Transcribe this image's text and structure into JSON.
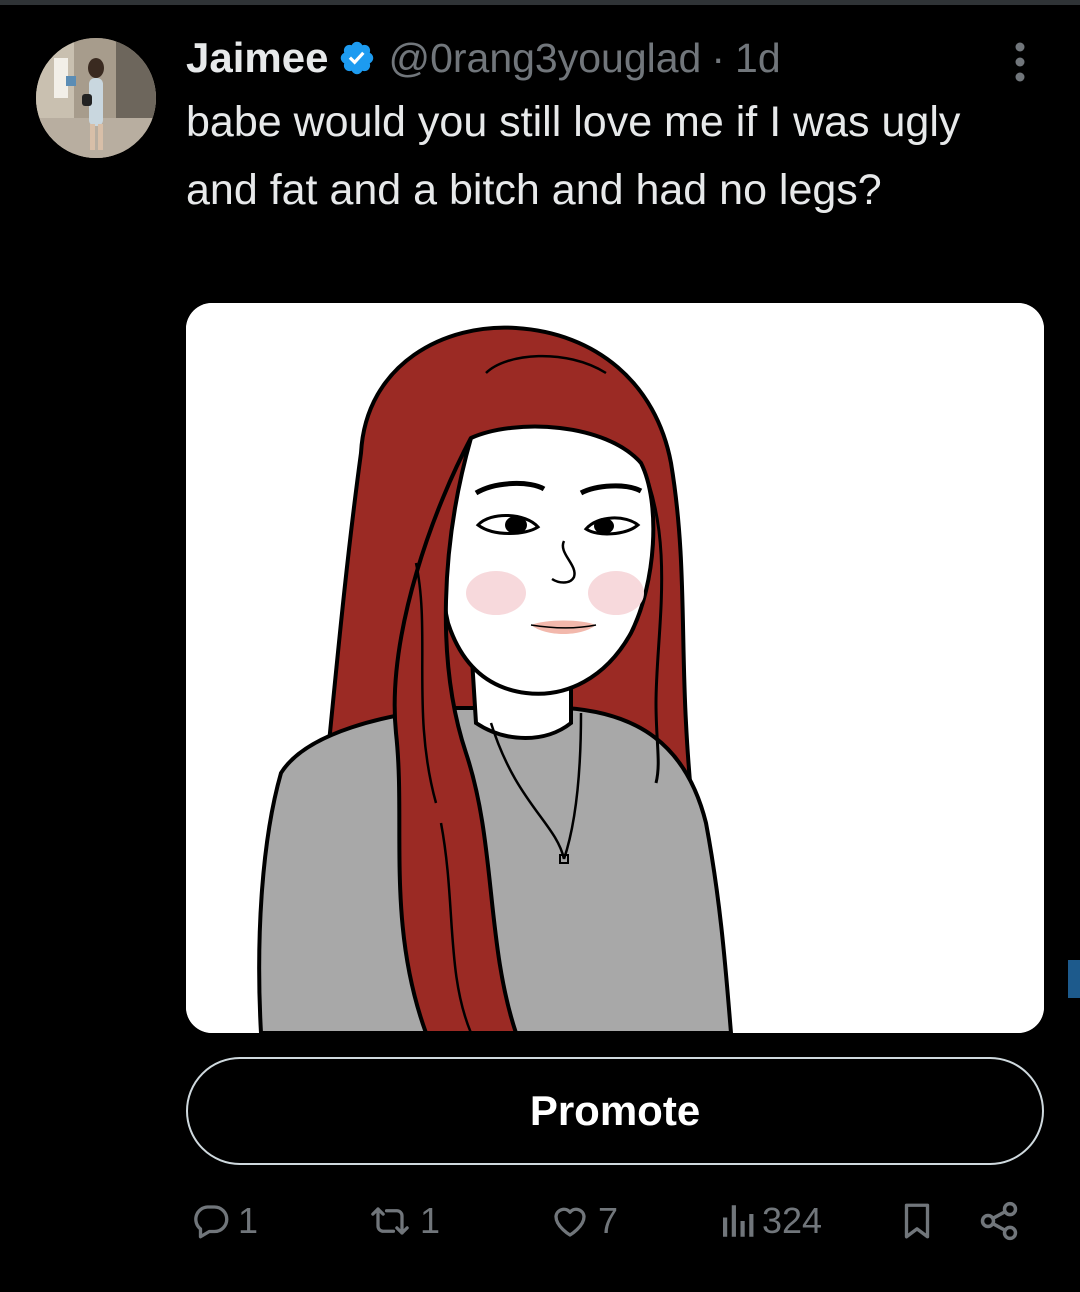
{
  "tweet": {
    "author": {
      "name": "Jaimee",
      "handle": "@0rang3youglad",
      "verified": true
    },
    "separator": "·",
    "time": "1d",
    "text": "babe would you still love me if I was ugly and fat and a bitch and had no legs?",
    "media": {
      "type": "illustration",
      "hair_color": "#9b2a24",
      "shirt_color": "#a8a8a8"
    }
  },
  "promote_button": {
    "label": "Promote"
  },
  "actions": {
    "replies": "1",
    "retweets": "1",
    "likes": "7",
    "views": "324"
  },
  "colors": {
    "background": "#000000",
    "text": "#e7e9ea",
    "secondary": "#71767b",
    "verified_badge": "#1d9bf0"
  },
  "icons": [
    "verified-icon",
    "more-icon",
    "reply-icon",
    "retweet-icon",
    "like-icon",
    "views-icon",
    "bookmark-icon",
    "share-icon"
  ]
}
